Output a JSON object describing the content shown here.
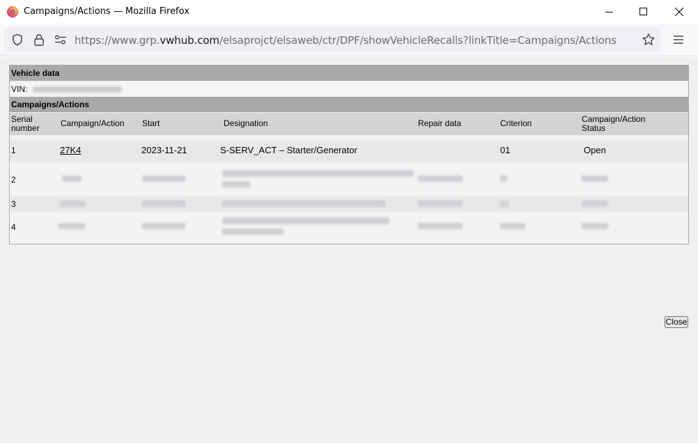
{
  "window": {
    "title": "Campaigns/Actions — Mozilla Firefox"
  },
  "navbar": {
    "url_prefix": "https://www.grp.",
    "url_domain": "vwhub.com",
    "url_suffix": "/elsaprojct/elsaweb/ctr/DPF/showVehicleRecalls?linkTitle=Campaigns/Actions"
  },
  "vehicle_data": {
    "heading": "Vehicle data",
    "vin_label": "VIN:"
  },
  "campaigns": {
    "heading": "Campaigns/Actions",
    "columns": {
      "serial": [
        "Serial",
        "number"
      ],
      "campaign": "Campaign/Action",
      "start": "Start",
      "designation": "Designation",
      "repair": "Repair data",
      "criterion": "Criterion",
      "status": [
        "Campaign/Action",
        "Status"
      ]
    },
    "rows": [
      {
        "serial": "1",
        "campaign": "27K4",
        "start": "2023-11-21",
        "designation": "S-SERV_ACT – Starter/Generator",
        "repair": "",
        "criterion": "01",
        "status": "Open"
      },
      {
        "serial": "2"
      },
      {
        "serial": "3"
      },
      {
        "serial": "4"
      }
    ]
  },
  "footer": {
    "close_label": "Close"
  }
}
